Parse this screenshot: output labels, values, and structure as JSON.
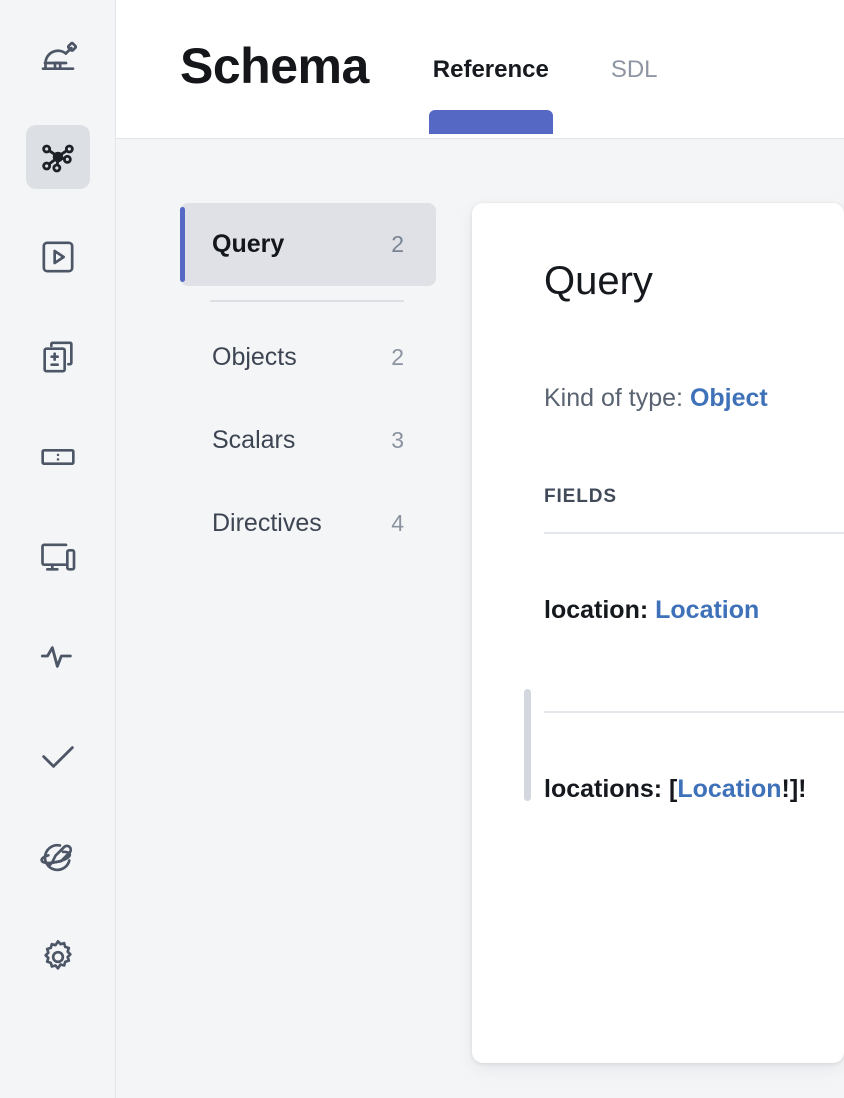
{
  "rail": {
    "items": [
      {
        "name": "home-observatory-icon",
        "label": "Home",
        "active": false
      },
      {
        "name": "schema-graph-icon",
        "label": "Schema",
        "active": true
      },
      {
        "name": "explorer-play-icon",
        "label": "Explorer",
        "active": false
      },
      {
        "name": "changelog-icon",
        "label": "Changelog",
        "active": false
      },
      {
        "name": "fields-icon",
        "label": "Fields",
        "active": false
      },
      {
        "name": "clients-icon",
        "label": "Clients",
        "active": false
      },
      {
        "name": "metrics-pulse-icon",
        "label": "Metrics",
        "active": false
      },
      {
        "name": "checks-icon",
        "label": "Checks",
        "active": false
      },
      {
        "name": "launches-rocket-icon",
        "label": "Launches",
        "active": false
      },
      {
        "name": "settings-gear-icon",
        "label": "Settings",
        "active": false
      }
    ]
  },
  "header": {
    "title": "Schema",
    "tabs": [
      {
        "label": "Reference",
        "active": true
      },
      {
        "label": "SDL",
        "active": false
      }
    ]
  },
  "typelist": [
    {
      "label": "Query",
      "count": "2",
      "selected": true
    },
    {
      "label": "Objects",
      "count": "2",
      "selected": false
    },
    {
      "label": "Scalars",
      "count": "3",
      "selected": false
    },
    {
      "label": "Directives",
      "count": "4",
      "selected": false
    }
  ],
  "detail": {
    "title": "Query",
    "kind_prefix": "Kind of type:",
    "kind_value": "Object",
    "fields_label": "FIELDS",
    "fields": [
      {
        "name": "location:",
        "prefix": "",
        "type": "Location",
        "suffix": ""
      },
      {
        "name": "locations:",
        "prefix": "[",
        "type": "Location",
        "suffix": "!]!"
      }
    ]
  },
  "colors": {
    "accent": "#5468c4",
    "link": "#3f71b9",
    "page_bg": "#f4f5f7",
    "card_bg": "#ffffff",
    "selected_bg": "#dfe1e6"
  }
}
